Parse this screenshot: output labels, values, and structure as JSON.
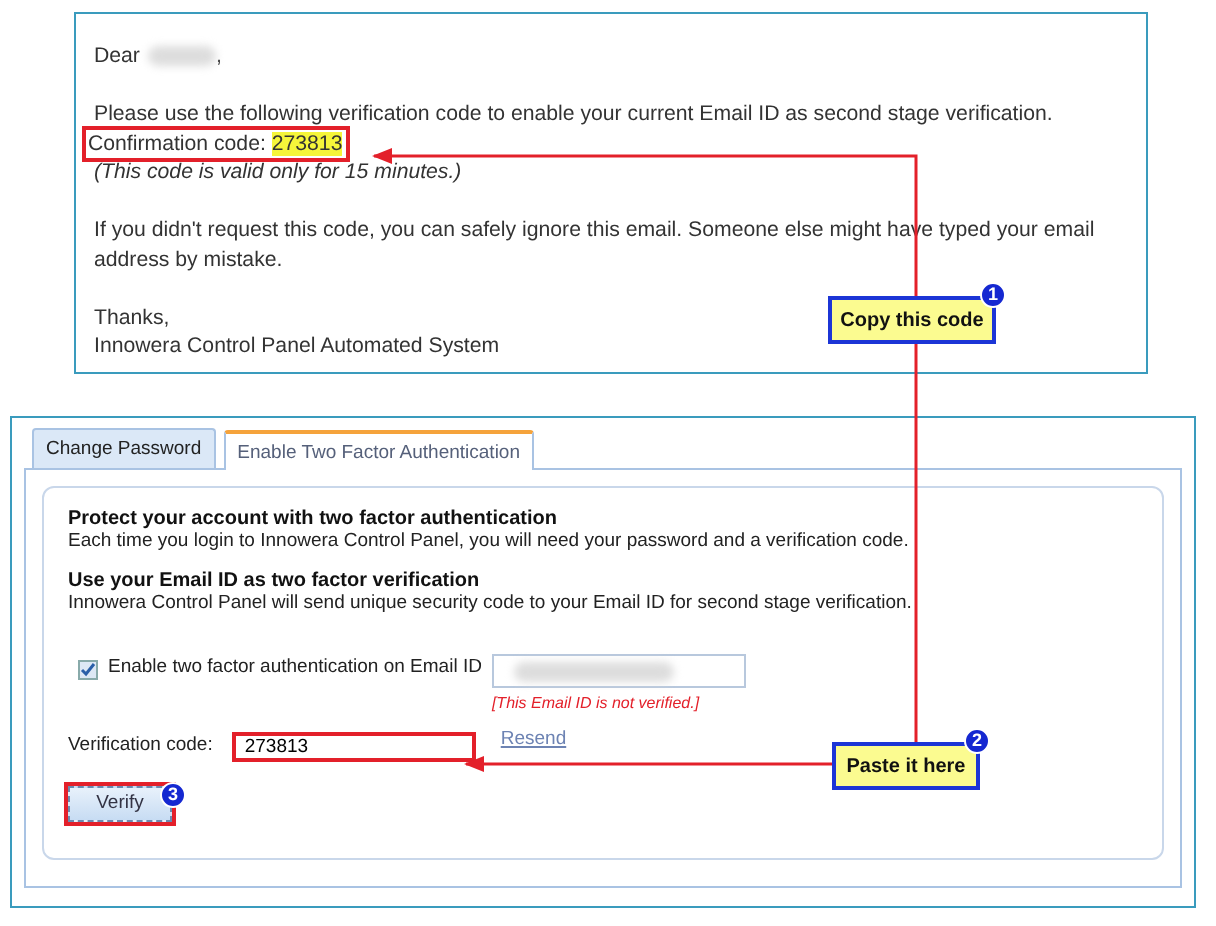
{
  "email": {
    "greeting": "Dear",
    "greeting_end": ",",
    "intro": "Please use the following verification code to enable your current Email ID as second stage verification.",
    "confirmation": {
      "label": "Confirmation code:",
      "code": "273813",
      "highlighted": true
    },
    "validity": "(This code is valid only for 15 minutes.)",
    "notice": "If you didn't request this code, you can safely ignore this email. Someone else might have typed your email address by mistake.",
    "closing": "Thanks,",
    "signature": "Innowera Control Panel Automated System"
  },
  "panel": {
    "tabs": [
      {
        "label": "Change Password",
        "selected": false
      },
      {
        "label": "Enable Two Factor Authentication",
        "selected": true
      }
    ],
    "sections": [
      {
        "heading": "Protect your account with two factor authentication",
        "text": "Each time you login to Innowera Control Panel, you will need your password and a verification code."
      },
      {
        "heading": "Use your Email ID as two factor verification",
        "text": "Innowera Control Panel will send unique security code to your Email ID for second stage verification."
      }
    ],
    "two_factor": {
      "label": "Enable two factor authentication on Email ID",
      "checked": true,
      "error": "[This Email ID is not verified.]"
    },
    "verification": {
      "label": "Verification code:",
      "value": "273813",
      "highlighted": true
    },
    "resend": "Resend",
    "verify_button": {
      "label": "Verify",
      "highlighted": true,
      "badge": "3"
    }
  },
  "callouts": [
    {
      "number": "1",
      "text": "Copy this code"
    },
    {
      "number": "2",
      "text": "Paste it here"
    }
  ]
}
